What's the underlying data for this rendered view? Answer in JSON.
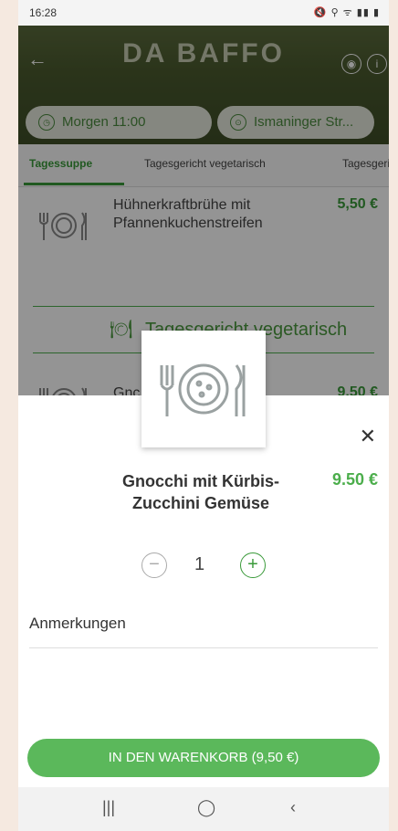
{
  "status": {
    "time": "16:28",
    "icons": "🔇 ⚲ ᯤ ▮▮ ▮"
  },
  "header": {
    "title": "DA BAFFO",
    "pickup_time": "Morgen 11:00",
    "location": "Ismaninger Str..."
  },
  "tabs": [
    "Tagessuppe",
    "Tagesgericht vegetarisch",
    "Tagesgeri"
  ],
  "menu": {
    "items": [
      {
        "name": "Hühnerkraftbrühe mit Pfannenkuchenstreifen",
        "price": "5,50 €"
      },
      {
        "name": "Gnocchi mit Kürbis-Zucchini Gemüse",
        "name_visible": "Gnc",
        "price": "9,50 €"
      }
    ],
    "section_heading": "Tagesgericht vegetarisch"
  },
  "sheet": {
    "dish_name": "Gnocchi mit Kürbis-Zucchini Gemüse",
    "price": "9.50 €",
    "quantity": "1",
    "notes_label": "Anmerkungen",
    "cart_button": "IN DEN WARENKORB (9,50 €)"
  },
  "navbar": {
    "recent": "|||",
    "home": "◯",
    "back": "‹"
  }
}
